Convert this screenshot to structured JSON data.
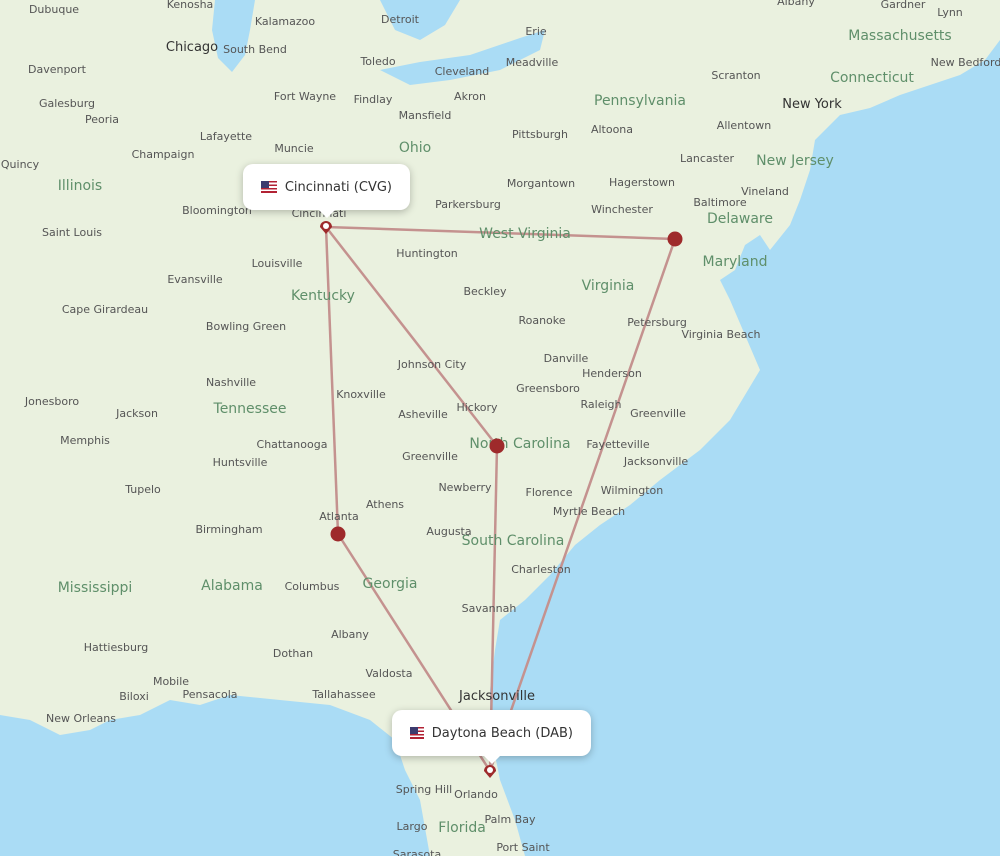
{
  "map": {
    "colors": {
      "land": "#eaf1df",
      "water": "#aadcf5",
      "route": "#c4928f",
      "hub": "#9e2a2b",
      "state_label": "#5f8f6a"
    },
    "origin": {
      "label": "Cincinnati (CVG)",
      "code": "CVG",
      "flag": "us-flag-icon"
    },
    "destination": {
      "label": "Daytona Beach (DAB)",
      "code": "DAB",
      "flag": "us-flag-icon"
    },
    "stops": [
      "Atlanta",
      "Charlotte",
      "Washington"
    ],
    "states": [
      "Illinois",
      "Ohio",
      "Pennsylvania",
      "Massachusetts",
      "Connecticut",
      "New Jersey",
      "Delaware",
      "Maryland",
      "West Virginia",
      "Virginia",
      "Kentucky",
      "Tennessee",
      "North Carolina",
      "South Carolina",
      "Georgia",
      "Alabama",
      "Mississippi",
      "Florida"
    ],
    "big_cities": [
      "Chicago",
      "New York",
      "Jacksonville"
    ],
    "places": [
      "Dubuque",
      "Kenosha",
      "Detroit",
      "Erie",
      "Albany",
      "Gardner",
      "Lynn",
      "Kalamazoo",
      "South Bend",
      "Toledo",
      "Cleveland",
      "Meadville",
      "Davenport",
      "Galesburg",
      "Peoria",
      "Fort Wayne",
      "Findlay",
      "Akron",
      "Mansfield",
      "Scranton",
      "New Bedford",
      "Champaign",
      "Lafayette",
      "Muncie",
      "Pittsburgh",
      "Altoona",
      "Allentown",
      "Quincy",
      "Bloomington",
      "Cincinnati",
      "Morgantown",
      "Hagerstown",
      "Lancaster",
      "Parkersburg",
      "Winchester",
      "Baltimore",
      "Vineland",
      "Saint Louis",
      "Louisville",
      "Huntington",
      "Evansville",
      "Cape Girardeau",
      "Beckley",
      "Roanoke",
      "Petersburg",
      "Virginia Beach",
      "Bowling Green",
      "Danville",
      "Henderson",
      "Johnson City",
      "Greensboro",
      "Raleigh",
      "Greenville",
      "Nashville",
      "Knoxville",
      "Jonesboro",
      "Jackson",
      "Hickory",
      "Asheville",
      "Memphis",
      "Fayetteville",
      "Jacksonville",
      "Chattanooga",
      "Huntsville",
      "Greenville",
      "Tupelo",
      "Newberry",
      "Florence",
      "Wilmington",
      "Myrtle Beach",
      "Athens",
      "Atlanta",
      "Birmingham",
      "Augusta",
      "Charleston",
      "Columbus",
      "Savannah",
      "Hattiesburg",
      "Albany",
      "Dothan",
      "Valdosta",
      "Mobile",
      "Pensacola",
      "Biloxi",
      "Tallahassee",
      "New Orleans",
      "Spring Hill",
      "Orlando",
      "Largo",
      "Palm Bay",
      "Port Saint",
      "Sarasota"
    ]
  }
}
